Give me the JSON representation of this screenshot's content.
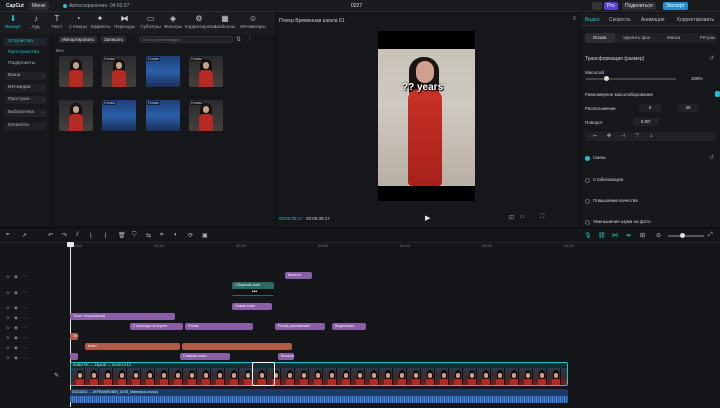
{
  "app": {
    "logo": "CapCut",
    "menu_label": "Меню",
    "autosave_status": "Автосохранение: 04:03:37",
    "project_title": "0227",
    "pro_badge": "Pro",
    "share_label": "Поделиться",
    "export_label": "Экспорт"
  },
  "toolbar": {
    "tools": [
      {
        "label": "Импорт",
        "icon": "import-icon"
      },
      {
        "label": "Ауд.",
        "icon": "audio-icon"
      },
      {
        "label": "Текст",
        "icon": "text-icon"
      },
      {
        "label": "Стикеры",
        "icon": "sticker-icon"
      },
      {
        "label": "Эффекты",
        "icon": "effects-icon"
      },
      {
        "label": "Переходы",
        "icon": "transitions-icon"
      },
      {
        "label": "Субтитры",
        "icon": "subtitles-icon"
      },
      {
        "label": "Фильтры",
        "icon": "filters-icon"
      },
      {
        "label": "Корректировка",
        "icon": "adjust-icon"
      },
      {
        "label": "Шаблоны",
        "icon": "templates-icon"
      },
      {
        "label": "ИИ-аватары",
        "icon": "ai-avatar-icon"
      }
    ]
  },
  "sidebar": {
    "items": [
      {
        "label": "Устройство",
        "chev": ""
      },
      {
        "label": "Пространство",
        "chev": ""
      },
      {
        "label": "Подпроекты",
        "chev": ""
      },
      {
        "label": "Ваши",
        "chev": "›"
      },
      {
        "label": "ИИ-медиа",
        "chev": "›"
      },
      {
        "label": "Простран...",
        "chev": "›"
      },
      {
        "label": "Библиотека",
        "chev": "›"
      },
      {
        "label": "Dreamina",
        "chev": ""
      }
    ]
  },
  "media": {
    "import_label": "Импортировать",
    "record_label": "Записать",
    "search_placeholder": "Поиск мультимедиа",
    "all_label": "Все",
    "thumbs": [
      {
        "tag": "",
        "cap": "",
        "style": "woman"
      },
      {
        "tag": "Готово",
        "cap": "",
        "style": "woman"
      },
      {
        "tag": "Готово",
        "cap": "",
        "style": "blue"
      },
      {
        "tag": "Готово",
        "cap": "",
        "style": "woman"
      },
      {
        "tag": "",
        "cap": "",
        "style": "woman"
      },
      {
        "tag": "Готово",
        "cap": "",
        "style": "blue"
      },
      {
        "tag": "Готово",
        "cap": "",
        "style": "blue"
      },
      {
        "tag": "Готово",
        "cap": "",
        "style": "woman"
      }
    ]
  },
  "player": {
    "title": "Плеер Временная шкала 01",
    "overlay_text": "?? years",
    "timecode": "00:00:05:17",
    "duration": "00:00:30:17"
  },
  "right_panel": {
    "tabs": [
      "Видео",
      "Скорость",
      "Анимация",
      "Корректировать"
    ],
    "subtabs": [
      "Основ.",
      "Удалить фон",
      "Маска",
      "Ретушь"
    ],
    "transform_label": "Трансформация (размер)",
    "scale_label": "Масштаб",
    "scale_value": "100%",
    "uniform_label": "Равномерное масштабирование",
    "position_label": "Расположение",
    "pos_x": "0",
    "pos_y": "30",
    "rotate_label": "Поворот",
    "rotate_value": "0.00°",
    "blend_label": "Смеш.",
    "stabilize_label": "Стабилизация",
    "enhance_label": "Повышение качества",
    "denoise_label": "Уменьшение шума на фото"
  },
  "timeline": {
    "ruler": [
      "00:00",
      "00:10",
      "00:20",
      "00:30",
      "00:40",
      "00:50",
      "01:00"
    ],
    "text_clips": [
      {
        "label": "Весело",
        "color": "#8a5fa8"
      },
      {
        "label": "Сборный клип",
        "color": "#3e8f86"
      },
      {
        "label": "Новая клип",
        "color": "#8a5fa8"
      },
      {
        "label": "Текст популярный",
        "color": "#8a5fa8"
      },
      {
        "label": "2 эпизода на сцене",
        "color": "#8a5fa8"
      },
      {
        "label": "Ролик",
        "color": "#8a5fa8"
      },
      {
        "label": "Ролик-рекламный",
        "color": "#8a5fa8"
      },
      {
        "label": "Видеоклип",
        "color": "#8a5fa8"
      },
      {
        "label": "Текст",
        "color": "#b05a48"
      },
      {
        "label": "Клип",
        "color": "#b05a48"
      },
      {
        "label": "Главная клип",
        "color": "#8a5fa8"
      },
      {
        "label": "Весело",
        "color": "#8a5fa8"
      }
    ],
    "main_clip_label": "KUBOTIK — 13ps18 — 00:00:12:12",
    "audio_label": "DUDUDU ... JEFRANROBIN_AXIS_Maine(not-music)",
    "cover_label": "Обложка"
  }
}
